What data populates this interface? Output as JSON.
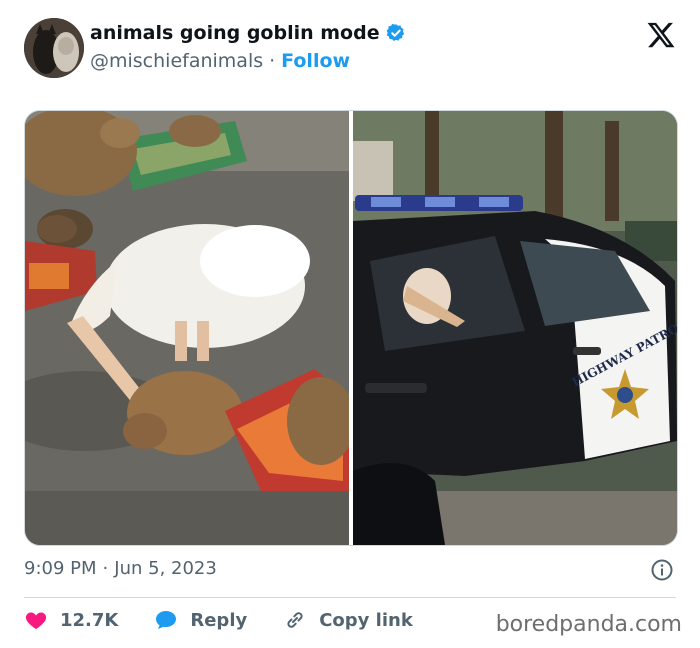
{
  "tweet": {
    "display_name": "animals going goblin mode",
    "handle": "@mischiefanimals",
    "separator": "·",
    "follow_label": "Follow",
    "time": "9:09 PM",
    "date_separator": "·",
    "date": "Jun 5, 2023",
    "likes": "12.7K",
    "reply_label": "Reply",
    "copy_link_label": "Copy link",
    "verified": true
  },
  "media": {
    "left_image": "pelican-eating-with-capybaras",
    "right_image": "pelican-in-highway-patrol-car",
    "door_text": "HIGHWAY PATROL"
  },
  "watermark": "boredpanda.com",
  "colors": {
    "accent": "#1d9bf0",
    "like": "#f91880",
    "muted": "#536471"
  },
  "icons": [
    "verified-badge-icon",
    "x-logo-icon",
    "info-icon",
    "heart-icon",
    "reply-bubble-icon",
    "link-icon"
  ]
}
